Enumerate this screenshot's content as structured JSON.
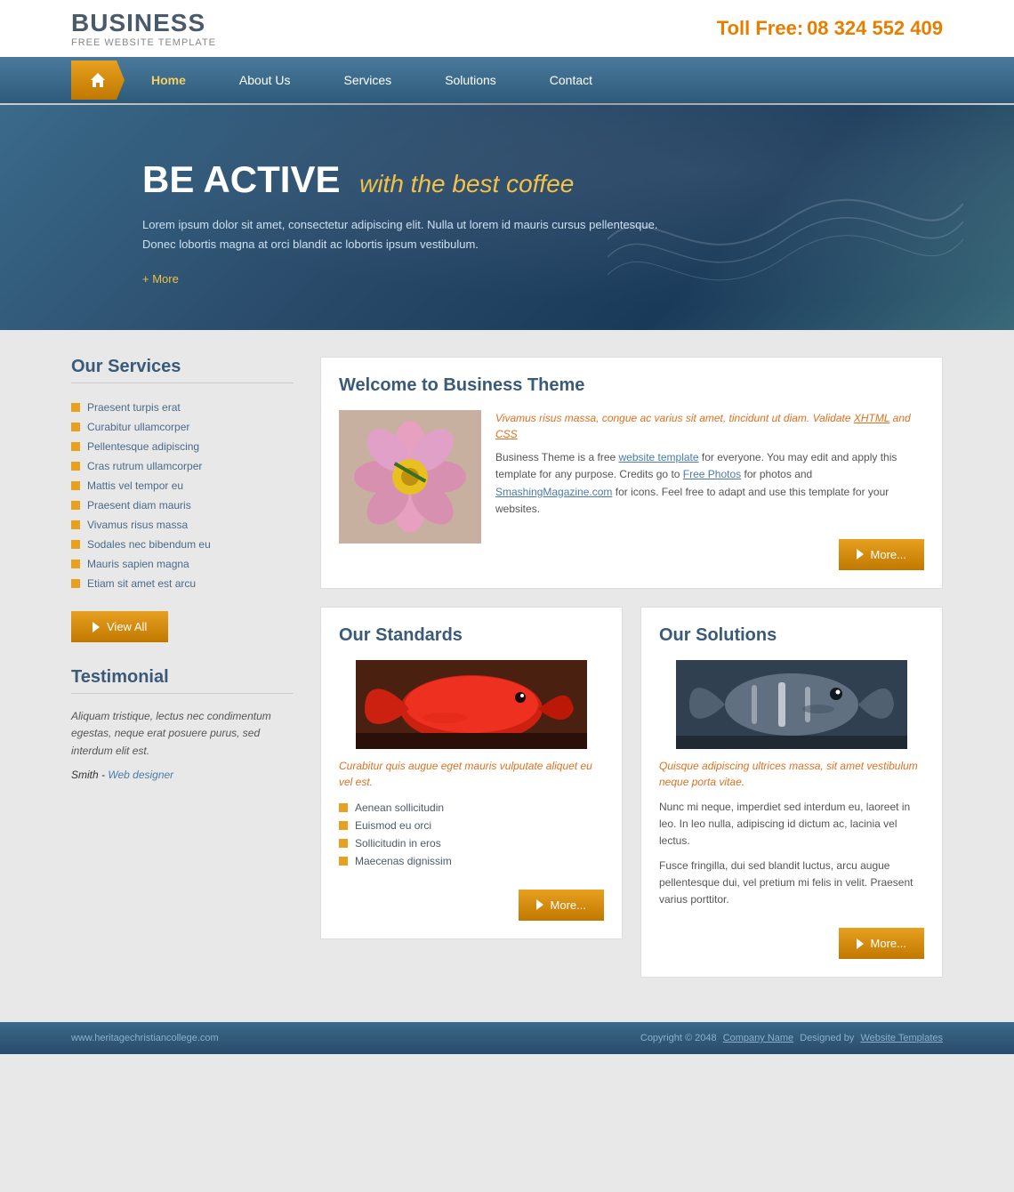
{
  "header": {
    "site_name": "BUSINESS",
    "tagline": "FREE WEBSITE TEMPLATE",
    "toll_free_label": "Toll Free:",
    "phone": "08 324 552 409"
  },
  "nav": {
    "home_label": "Home",
    "items": [
      {
        "label": "Home",
        "active": true
      },
      {
        "label": "About Us"
      },
      {
        "label": "Services"
      },
      {
        "label": "Solutions"
      },
      {
        "label": "Contact"
      }
    ]
  },
  "hero": {
    "title": "BE ACTIVE",
    "subtitle": "with the best coffee",
    "description": "Lorem ipsum dolor sit amet, consectetur adipiscing elit. Nulla ut lorem id mauris cursus pellentesque.\nDonec lobortis magna at orci blandit ac lobortis ipsum vestibulum.",
    "more_label": "+ More"
  },
  "sidebar": {
    "services_title": "Our Services",
    "services": [
      "Praesent turpis erat",
      "Curabitur ullamcorper",
      "Pellentesque adipiscing",
      "Cras rutrum ullamcorper",
      "Mattis vel tempor eu",
      "Praesent diam mauris",
      "Vivamus risus massa",
      "Sodales nec bibendum eu",
      "Mauris sapien magna",
      "Etiam sit amet est arcu"
    ],
    "view_all_label": "View All",
    "testimonial_title": "Testimonial",
    "testimonial_text": "Aliquam tristique, lectus nec condimentum egestas, neque erat posuere purus, sed interdum elit est.",
    "testimonial_author": "Smith",
    "testimonial_author_role": "Web designer"
  },
  "welcome": {
    "title": "Welcome to Business Theme",
    "orange_text": "Vivamus risus massa, congue ac varius sit amet, tincidunt ut diam. Validate XHTML and CSS",
    "body_text": "Business Theme is a free website template for everyone. You may edit and apply this template for any purpose. Credits go to Free Photos for photos and SmashingMagazine.com for icons. Feel free to adapt and use this template for your websites.",
    "more_label": "More..."
  },
  "standards": {
    "title": "Our Standards",
    "orange_text": "Curabitur quis augue eget mauris vulputate aliquet eu vel est.",
    "list": [
      "Aenean sollicitudin",
      "Euismod eu orci",
      "Sollicitudin in eros",
      "Maecenas dignissim"
    ],
    "more_label": "More..."
  },
  "solutions": {
    "title": "Our Solutions",
    "orange_text": "Quisque adipiscing ultrices massa, sit amet vestibulum neque porta vitae.",
    "para1": "Nunc mi neque, imperdiet sed interdum eu, laoreet in leo. In leo nulla, adipiscing id dictum ac, lacinia vel lectus.",
    "para2": "Fusce fringilla, dui sed blandit luctus, arcu augue pellentesque dui, vel pretium mi felis in velit. Praesent varius porttitor.",
    "more_label": "More..."
  },
  "footer": {
    "website": "www.heritagechristiancollege.com",
    "copyright": "Copyright © 2048",
    "company_name": "Company Name",
    "designed_by": "Designed by",
    "website_templates": "Website Templates"
  }
}
